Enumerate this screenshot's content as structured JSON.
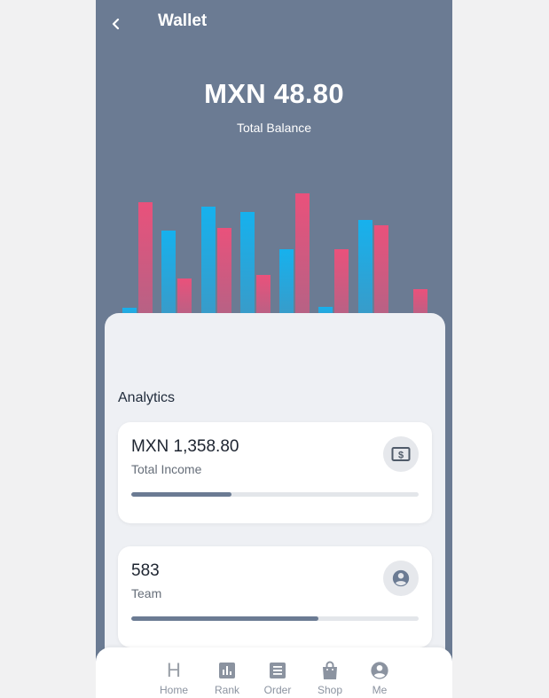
{
  "header": {
    "title": "Wallet"
  },
  "wallet": {
    "balance": "MXN 48.80",
    "balance_label": "Total Balance"
  },
  "analytics": {
    "title": "Analytics",
    "cards": [
      {
        "value": "MXN 1,358.80",
        "label": "Total Income",
        "icon": "cash-icon",
        "progress": 0.35
      },
      {
        "value": "583",
        "label": "Team",
        "icon": "account-circle-icon",
        "progress": 0.65
      }
    ]
  },
  "tabbar": {
    "items": [
      {
        "label": "Home",
        "icon": "H"
      },
      {
        "label": "Rank",
        "icon": "bar-chart-icon"
      },
      {
        "label": "Order",
        "icon": "list-icon"
      },
      {
        "label": "Shop",
        "icon": "shopping-bag-icon"
      },
      {
        "label": "Me",
        "icon": "account-circle-icon"
      }
    ]
  },
  "colors": {
    "header_bg": "#6b7b93",
    "bar_blue": "#12b4f2",
    "bar_pink": "#f04f7a",
    "sheet_bg": "#eef0f4"
  }
}
